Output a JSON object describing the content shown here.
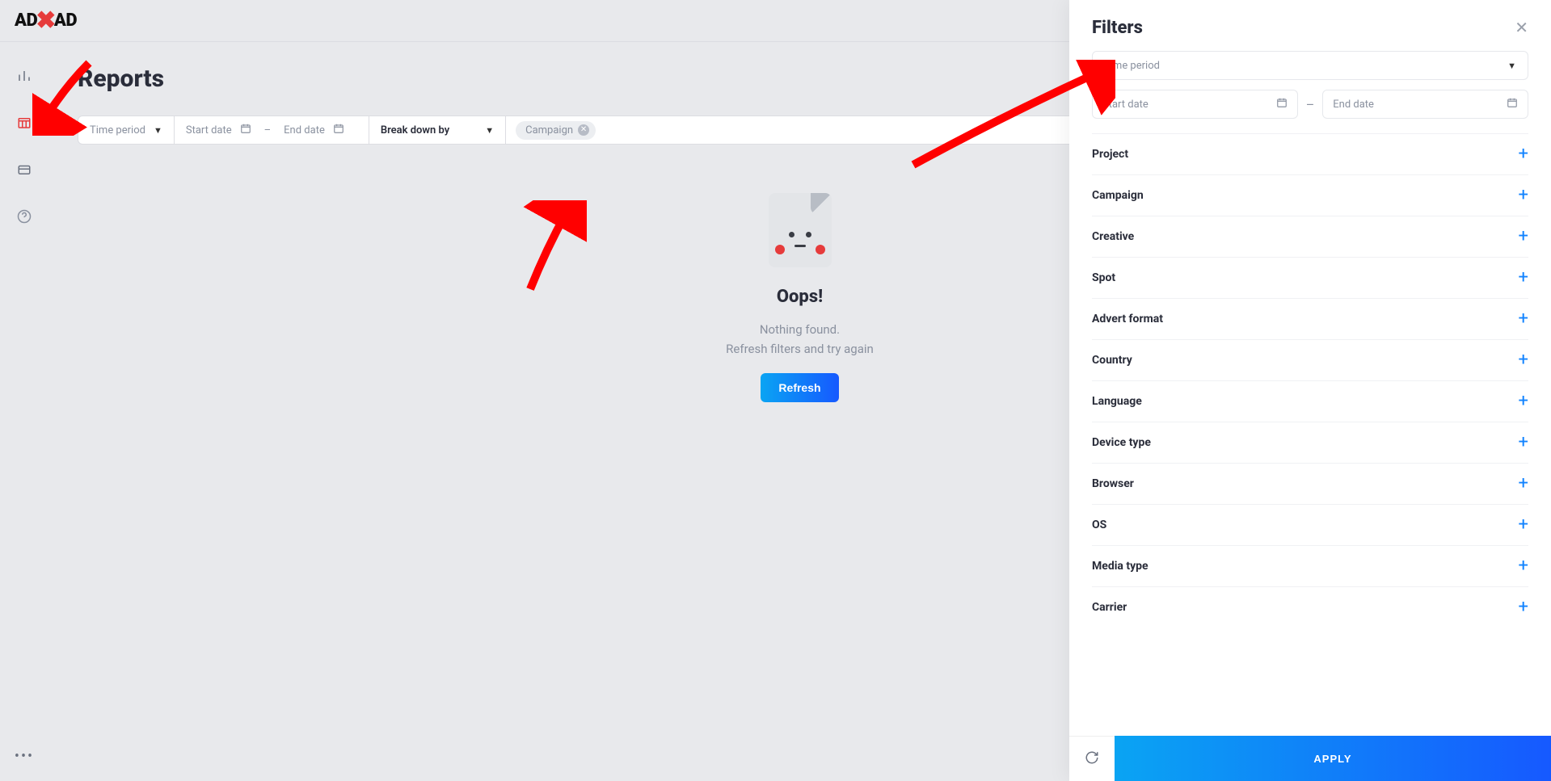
{
  "logo": {
    "left": "AD",
    "right": "AD"
  },
  "page": {
    "title": "Reports"
  },
  "toolbar": {
    "time_period": "Time period",
    "start_date": "Start date",
    "end_date": "End date",
    "breakdown": "Break down by",
    "chip_label": "Campaign"
  },
  "empty": {
    "title": "Oops!",
    "line1": "Nothing found.",
    "line2": "Refresh filters and try again",
    "button": "Refresh"
  },
  "filters": {
    "title": "Filters",
    "time_period": "Time period",
    "start_date": "Start date",
    "end_date": "End date",
    "apply": "APPLY",
    "items": [
      {
        "label": "Project"
      },
      {
        "label": "Campaign"
      },
      {
        "label": "Creative"
      },
      {
        "label": "Spot"
      },
      {
        "label": "Advert format"
      },
      {
        "label": "Country"
      },
      {
        "label": "Language"
      },
      {
        "label": "Device type"
      },
      {
        "label": "Browser"
      },
      {
        "label": "OS"
      },
      {
        "label": "Media type"
      },
      {
        "label": "Carrier"
      }
    ]
  }
}
